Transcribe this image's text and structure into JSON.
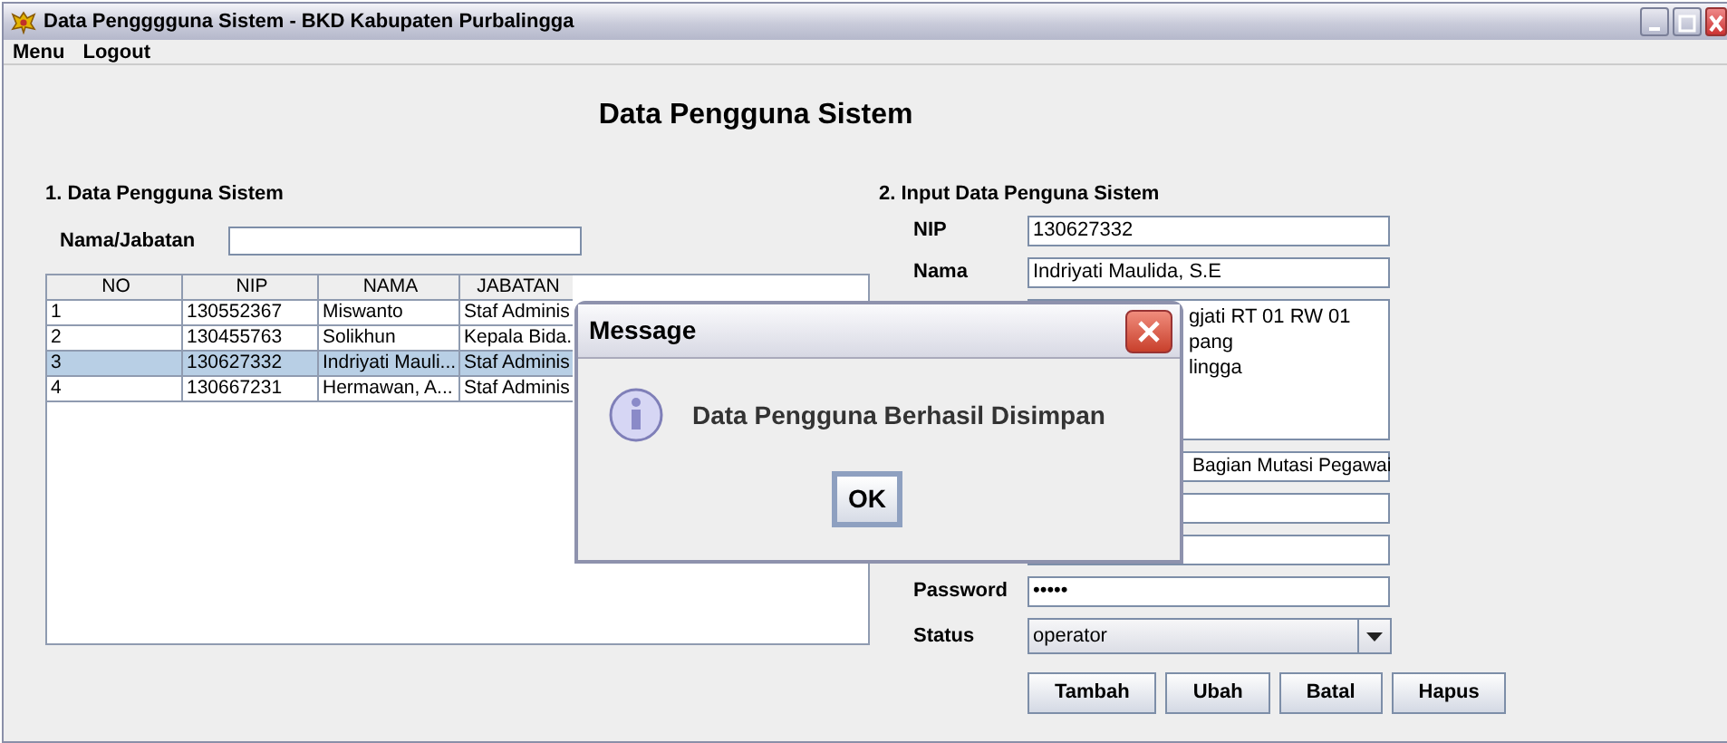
{
  "window": {
    "title": "Data Pengggguna Sistem - BKD Kabupaten Purbalingga"
  },
  "menu": [
    "Menu",
    "Logout"
  ],
  "heading": "Data Pengguna Sistem",
  "left_panel": {
    "title": "1. Data Pengguna Sistem",
    "search": {
      "label": "Nama/Jabatan"
    }
  },
  "table": {
    "columns": [
      "NO",
      "NIP",
      "NAMA",
      "JABATAN"
    ],
    "rows": [
      {
        "cells": [
          "1",
          "130552367",
          "Miswanto",
          "Staf Adminis"
        ],
        "selected": false
      },
      {
        "cells": [
          "2",
          "130455763",
          "Solikhun",
          "Kepala Bida."
        ],
        "selected": false
      },
      {
        "cells": [
          "3",
          "130627332",
          "Indriyati Mauli...",
          "Staf Adminis"
        ],
        "selected": true
      },
      {
        "cells": [
          "4",
          "130667231",
          "Hermawan, A...",
          "Staf Adminis"
        ],
        "selected": false
      }
    ]
  },
  "right_panel": {
    "title": "2. Input Data Penguna Sistem",
    "fields": [
      {
        "kind": "text",
        "label": "NIP",
        "value": "130627332"
      },
      {
        "kind": "text",
        "label": "Nama",
        "value": "Indriyati Maulida, S.E"
      },
      {
        "kind": "textarea",
        "lines": [
          "gjati RT 01 RW 01",
          "pang",
          "lingga"
        ]
      },
      {
        "kind": "text",
        "value": "Bagian Mutasi Pegawai"
      },
      {
        "kind": "text"
      },
      {
        "kind": "text"
      },
      {
        "kind": "password",
        "label": "Password",
        "value": "•••••"
      },
      {
        "kind": "combo",
        "label": "Status",
        "value": "operator"
      }
    ],
    "buttons": [
      "Tambah",
      "Ubah",
      "Batal",
      "Hapus"
    ]
  },
  "dialog": {
    "title": "Message",
    "message": "Data Pengguna Berhasil Disimpan",
    "button": "OK"
  }
}
